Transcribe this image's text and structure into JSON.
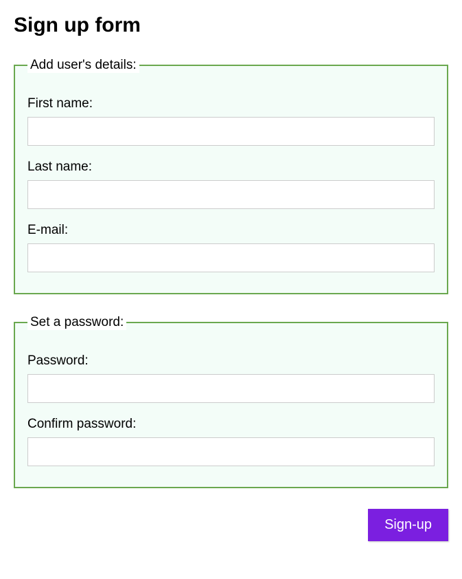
{
  "page": {
    "title": "Sign up form"
  },
  "fieldsets": {
    "details": {
      "legend": "Add user's details:",
      "fields": {
        "first_name": {
          "label": "First name:",
          "value": ""
        },
        "last_name": {
          "label": "Last name:",
          "value": ""
        },
        "email": {
          "label": "E-mail:",
          "value": ""
        }
      }
    },
    "password": {
      "legend": "Set a password:",
      "fields": {
        "password": {
          "label": "Password:",
          "value": ""
        },
        "confirm_password": {
          "label": "Confirm password:",
          "value": ""
        }
      }
    }
  },
  "actions": {
    "signup_label": "Sign-up"
  },
  "colors": {
    "fieldset_border": "#6aa84f",
    "fieldset_bg": "#f3fdf8",
    "button_bg": "#7b1fe0",
    "button_fg": "#ffffff"
  }
}
